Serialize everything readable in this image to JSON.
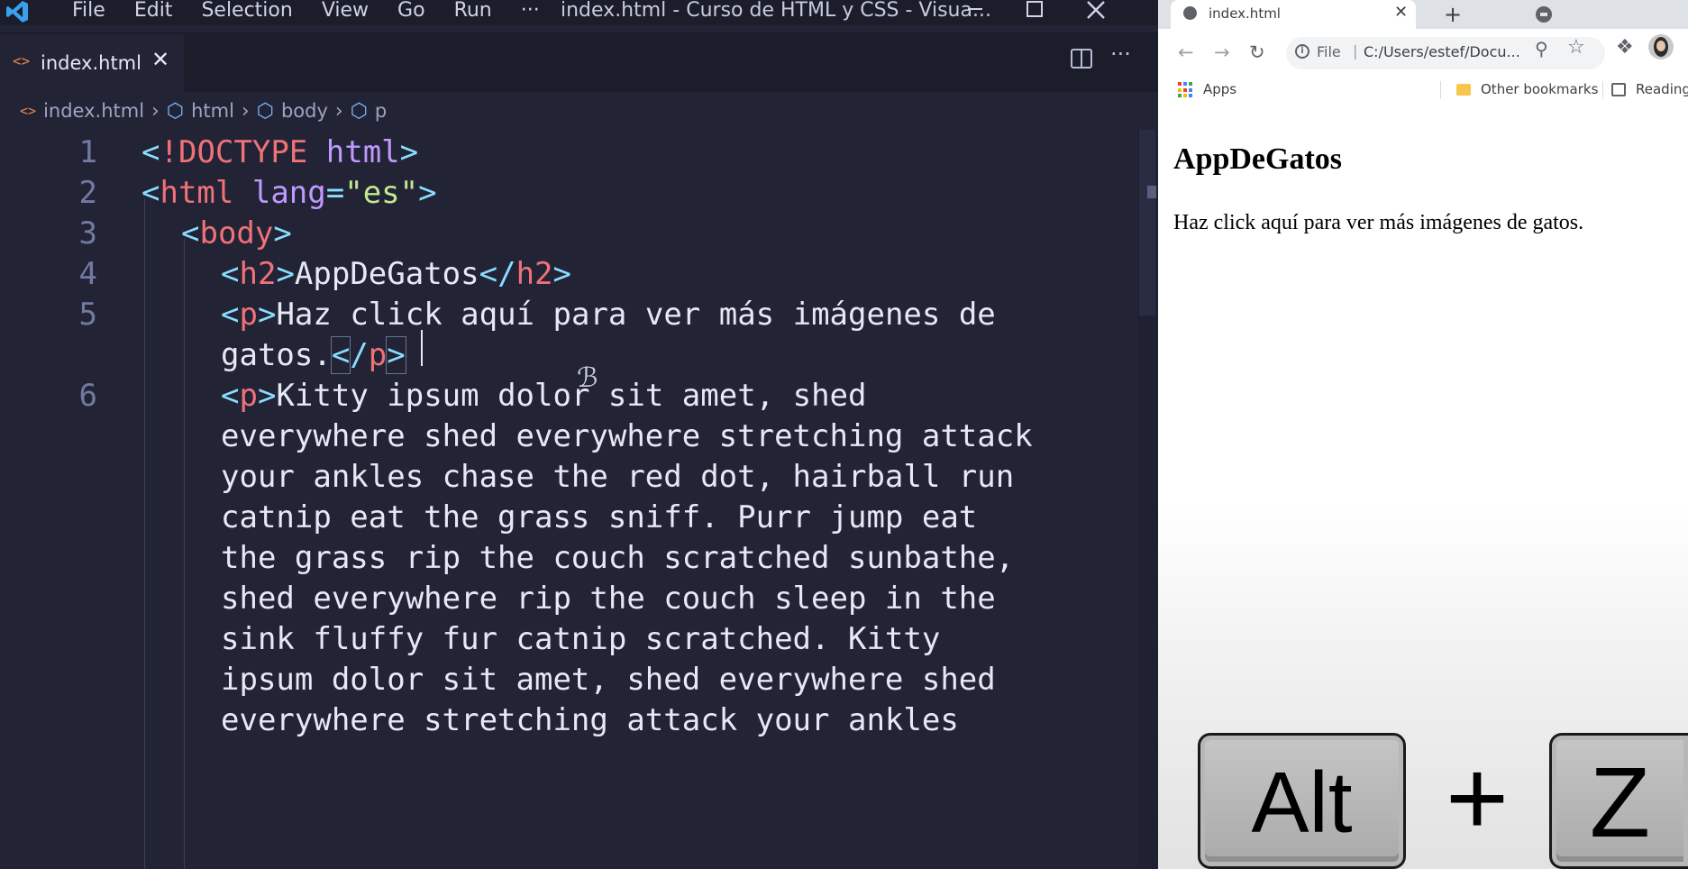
{
  "vscode": {
    "menu": [
      "File",
      "Edit",
      "Selection",
      "View",
      "Go",
      "Run",
      "···"
    ],
    "window_title": "index.html - Curso de HTML y CSS - Visua...",
    "tab": {
      "label": "index.html",
      "close": "✕"
    },
    "breadcrumb": {
      "file": "index.html",
      "items": [
        "html",
        "body",
        "p"
      ]
    },
    "line_numbers": [
      "1",
      "2",
      "3",
      "4",
      "5",
      "6"
    ],
    "code": {
      "l1": {
        "open": "<",
        "bang": "!",
        "doctype": "DOCTYPE",
        "html": "html",
        "close": ">"
      },
      "l2": {
        "tag": "html",
        "attr": "lang",
        "eq": "=",
        "value": "\"es\""
      },
      "l3": {
        "tag": "body"
      },
      "l4": {
        "tag": "h2",
        "text": "AppDeGatos"
      },
      "l5": {
        "tag": "p",
        "text_a": "Haz click aquí para ver más imágenes de",
        "text_b": "gatos."
      },
      "l6": {
        "tag": "p",
        "wrapped": [
          "Kitty ipsum dolor sit amet, shed",
          "everywhere shed everywhere stretching attack",
          "your ankles chase the red dot, hairball run",
          "catnip eat the grass sniff. Purr jump eat",
          "the grass rip the couch scratched sunbathe,",
          "shed everywhere rip the couch sleep in the",
          "sink fluffy fur catnip scratched. Kitty",
          "ipsum dolor sit amet, shed everywhere shed",
          "everywhere stretching attack your ankles"
        ]
      }
    },
    "colors": {
      "tag": "#f07178",
      "punct": "#89ddff",
      "attr": "#c099ff",
      "string": "#c3e88d",
      "text": "#e6e8f5",
      "background": "#222436"
    }
  },
  "browser": {
    "tab_title": "index.html",
    "tab_close": "✕",
    "new_tab": "+",
    "scheme": "File",
    "url": "C:/Users/estef/Docu...",
    "bookmarks": {
      "apps": "Apps",
      "other": "Other bookmarks",
      "reading": "Reading"
    },
    "page": {
      "heading": "AppDeGatos",
      "paragraph": "Haz click aquí para ver más imágenes de gatos."
    }
  },
  "shortcut_overlay": {
    "key1": "Alt",
    "plus": "+",
    "key2": "Z"
  }
}
